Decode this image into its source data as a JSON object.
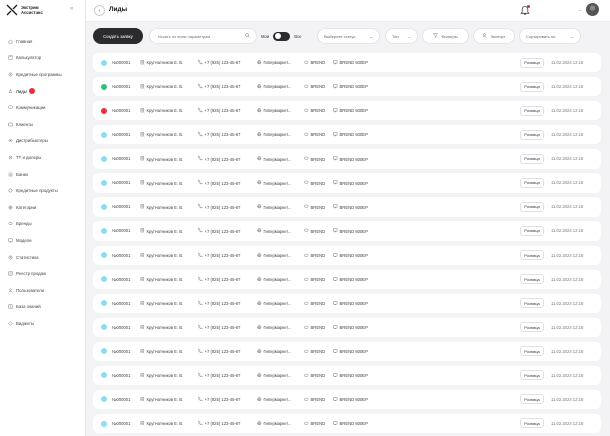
{
  "app": {
    "logo_line1": "Экстрим",
    "logo_line2": "Ассистанс"
  },
  "sidebar": {
    "items": [
      {
        "label": "Главная",
        "icon": "home-icon"
      },
      {
        "label": "Калькулятор",
        "icon": "calculator-icon"
      },
      {
        "label": "Кредитные программы",
        "icon": "credit-icon"
      },
      {
        "label": "Лиды",
        "icon": "leads-icon",
        "active": true,
        "badge": true
      },
      {
        "label": "Коммуникации",
        "icon": "chat-icon"
      },
      {
        "label": "Клиенты",
        "icon": "clients-icon"
      },
      {
        "label": "Дистрибьютеры",
        "icon": "distributors-icon"
      },
      {
        "label": "ТТ и дилеры",
        "icon": "dealers-icon"
      },
      {
        "label": "Банки",
        "icon": "bank-icon"
      },
      {
        "label": "Кредитные продукты",
        "icon": "product-icon"
      },
      {
        "label": "Категории",
        "icon": "categories-icon"
      },
      {
        "label": "Бренды",
        "icon": "brands-icon"
      },
      {
        "label": "Модели",
        "icon": "models-icon"
      },
      {
        "label": "Статистика",
        "icon": "stats-icon"
      },
      {
        "label": "Реестр продаж",
        "icon": "registry-icon"
      },
      {
        "label": "Пользователи",
        "icon": "users-icon"
      },
      {
        "label": "База знаний",
        "icon": "knowledge-icon"
      },
      {
        "label": "Виджеты",
        "icon": "widgets-icon"
      }
    ]
  },
  "header": {
    "title": "Лиды"
  },
  "toolbar": {
    "create_label": "Создать заявку",
    "search_placeholder": "Искать по всем параметрам",
    "toggle_left": "Мои",
    "toggle_right": "Все",
    "status_label": "Выберите статус",
    "type_label": "Тип",
    "filters_label": "Фильтры",
    "export_label": "Экспорт",
    "sort_label": "Сортировать по"
  },
  "colors": {
    "dot_default": "#8fdcf3",
    "dot_green": "#34c07a",
    "dot_red": "#e8303a",
    "accent_dark": "#2b2b2e"
  },
  "rows": [
    {
      "id": "№000001",
      "manager": "Крупчатников Е. В.",
      "phone": "+7 (925) 123-45-67",
      "shop": "Гипермаркет...",
      "brand": "BREND",
      "model": "BREND 500EP",
      "tag": "Розница",
      "date": "11.02.2024 12:18",
      "status": "default"
    },
    {
      "id": "№000001",
      "manager": "Крупчатников Е. В.",
      "phone": "+7 (925) 123-45-67",
      "shop": "Гипермаркет...",
      "brand": "BREND",
      "model": "BREND 500EP",
      "tag": "Розница",
      "date": "11.02.2024 12:18",
      "status": "green"
    },
    {
      "id": "№000001",
      "manager": "Крупчатников Е. В.",
      "phone": "+7 (925) 123-45-67",
      "shop": "Гипермаркет...",
      "brand": "BREND",
      "model": "BREND 500EP",
      "tag": "Розница",
      "date": "11.02.2024 12:18",
      "status": "red"
    },
    {
      "id": "№000001",
      "manager": "Крупчатников Е. В.",
      "phone": "+7 (925) 123-45-67",
      "shop": "Гипермаркет...",
      "brand": "BREND",
      "model": "BREND 500EP",
      "tag": "Розница",
      "date": "11.02.2024 12:18",
      "status": "default"
    },
    {
      "id": "№000001",
      "manager": "Крупчатников Е. В.",
      "phone": "+7 (925) 123-45-67",
      "shop": "Гипермаркет...",
      "brand": "BREND",
      "model": "BREND 500EP",
      "tag": "Розница",
      "date": "11.02.2024 12:18",
      "status": "default"
    },
    {
      "id": "№000001",
      "manager": "Крупчатников Е. В.",
      "phone": "+7 (925) 123-45-67",
      "shop": "Гипермаркет...",
      "brand": "BREND",
      "model": "BREND 500EP",
      "tag": "Розница",
      "date": "11.02.2024 12:18",
      "status": "default"
    },
    {
      "id": "№000001",
      "manager": "Крупчатников Е. В.",
      "phone": "+7 (925) 123-45-67",
      "shop": "Гипермаркет...",
      "brand": "BREND",
      "model": "BREND 500EP",
      "tag": "Розница",
      "date": "11.02.2024 12:18",
      "status": "default"
    },
    {
      "id": "№000001",
      "manager": "Крупчатников Е. В.",
      "phone": "+7 (925) 123-45-67",
      "shop": "Гипермаркет...",
      "brand": "BREND",
      "model": "BREND 500EP",
      "tag": "Розница",
      "date": "11.02.2024 12:18",
      "status": "default"
    },
    {
      "id": "№000001",
      "manager": "Крупчатников Е. В.",
      "phone": "+7 (925) 123-45-67",
      "shop": "Гипермаркет...",
      "brand": "BREND",
      "model": "BREND 500EP",
      "tag": "Розница",
      "date": "11.02.2024 12:18",
      "status": "default"
    },
    {
      "id": "№000001",
      "manager": "Крупчатников Е. В.",
      "phone": "+7 (925) 123-45-67",
      "shop": "Гипермаркет...",
      "brand": "BREND",
      "model": "BREND 500EP",
      "tag": "Розница",
      "date": "11.02.2024 12:18",
      "status": "default"
    },
    {
      "id": "№000001",
      "manager": "Крупчатников Е. В.",
      "phone": "+7 (925) 123-45-67",
      "shop": "Гипермаркет...",
      "brand": "BREND",
      "model": "BREND 500EP",
      "tag": "Розница",
      "date": "11.02.2024 12:18",
      "status": "default"
    },
    {
      "id": "№000001",
      "manager": "Крупчатников Е. В.",
      "phone": "+7 (925) 123-45-67",
      "shop": "Гипермаркет...",
      "brand": "BREND",
      "model": "BREND 500EP",
      "tag": "Розница",
      "date": "11.02.2024 12:18",
      "status": "default"
    },
    {
      "id": "№000001",
      "manager": "Крупчатников Е. В.",
      "phone": "+7 (925) 123-45-67",
      "shop": "Гипермаркет...",
      "brand": "BREND",
      "model": "BREND 500EP",
      "tag": "Розница",
      "date": "11.02.2024 12:18",
      "status": "default"
    },
    {
      "id": "№000001",
      "manager": "Крупчатников Е. В.",
      "phone": "+7 (925) 123-45-67",
      "shop": "Гипермаркет...",
      "brand": "BREND",
      "model": "BREND 500EP",
      "tag": "Розница",
      "date": "11.02.2024 12:18",
      "status": "default"
    },
    {
      "id": "№000001",
      "manager": "Крупчатников Е. В.",
      "phone": "+7 (925) 123-45-67",
      "shop": "Гипермаркет...",
      "brand": "BREND",
      "model": "BREND 500EP",
      "tag": "Розница",
      "date": "11.02.2024 12:18",
      "status": "default"
    },
    {
      "id": "№000001",
      "manager": "Крупчатников Е. В.",
      "phone": "+7 (925) 123-45-67",
      "shop": "Гипермаркет...",
      "brand": "BREND",
      "model": "BREND 500EP",
      "tag": "Розница",
      "date": "11.02.2024 12:18",
      "status": "default"
    }
  ]
}
